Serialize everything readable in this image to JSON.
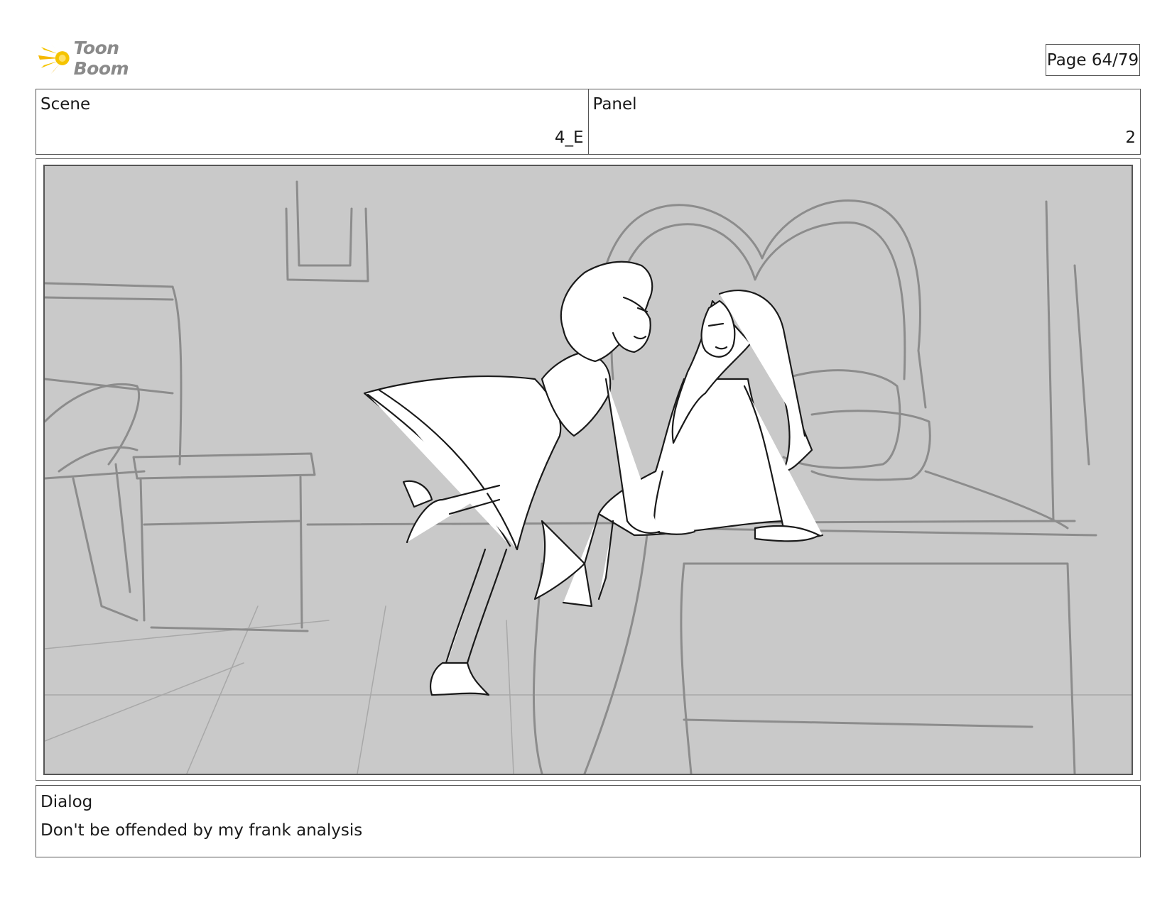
{
  "header": {
    "logo_text": "Toon Boom",
    "page_indicator": "Page 64/79"
  },
  "scene": {
    "label": "Scene",
    "value": "4_E"
  },
  "panel": {
    "label": "Panel",
    "value": "2"
  },
  "dialog": {
    "label": "Dialog",
    "text": "Don't be offended by my frank analysis"
  },
  "colors": {
    "logo_accent": "#f5c400",
    "frame_background": "#c9c9c9",
    "sketch_background_lines": "#8c8c8c",
    "sketch_character_lines": "#1a1a1a"
  }
}
